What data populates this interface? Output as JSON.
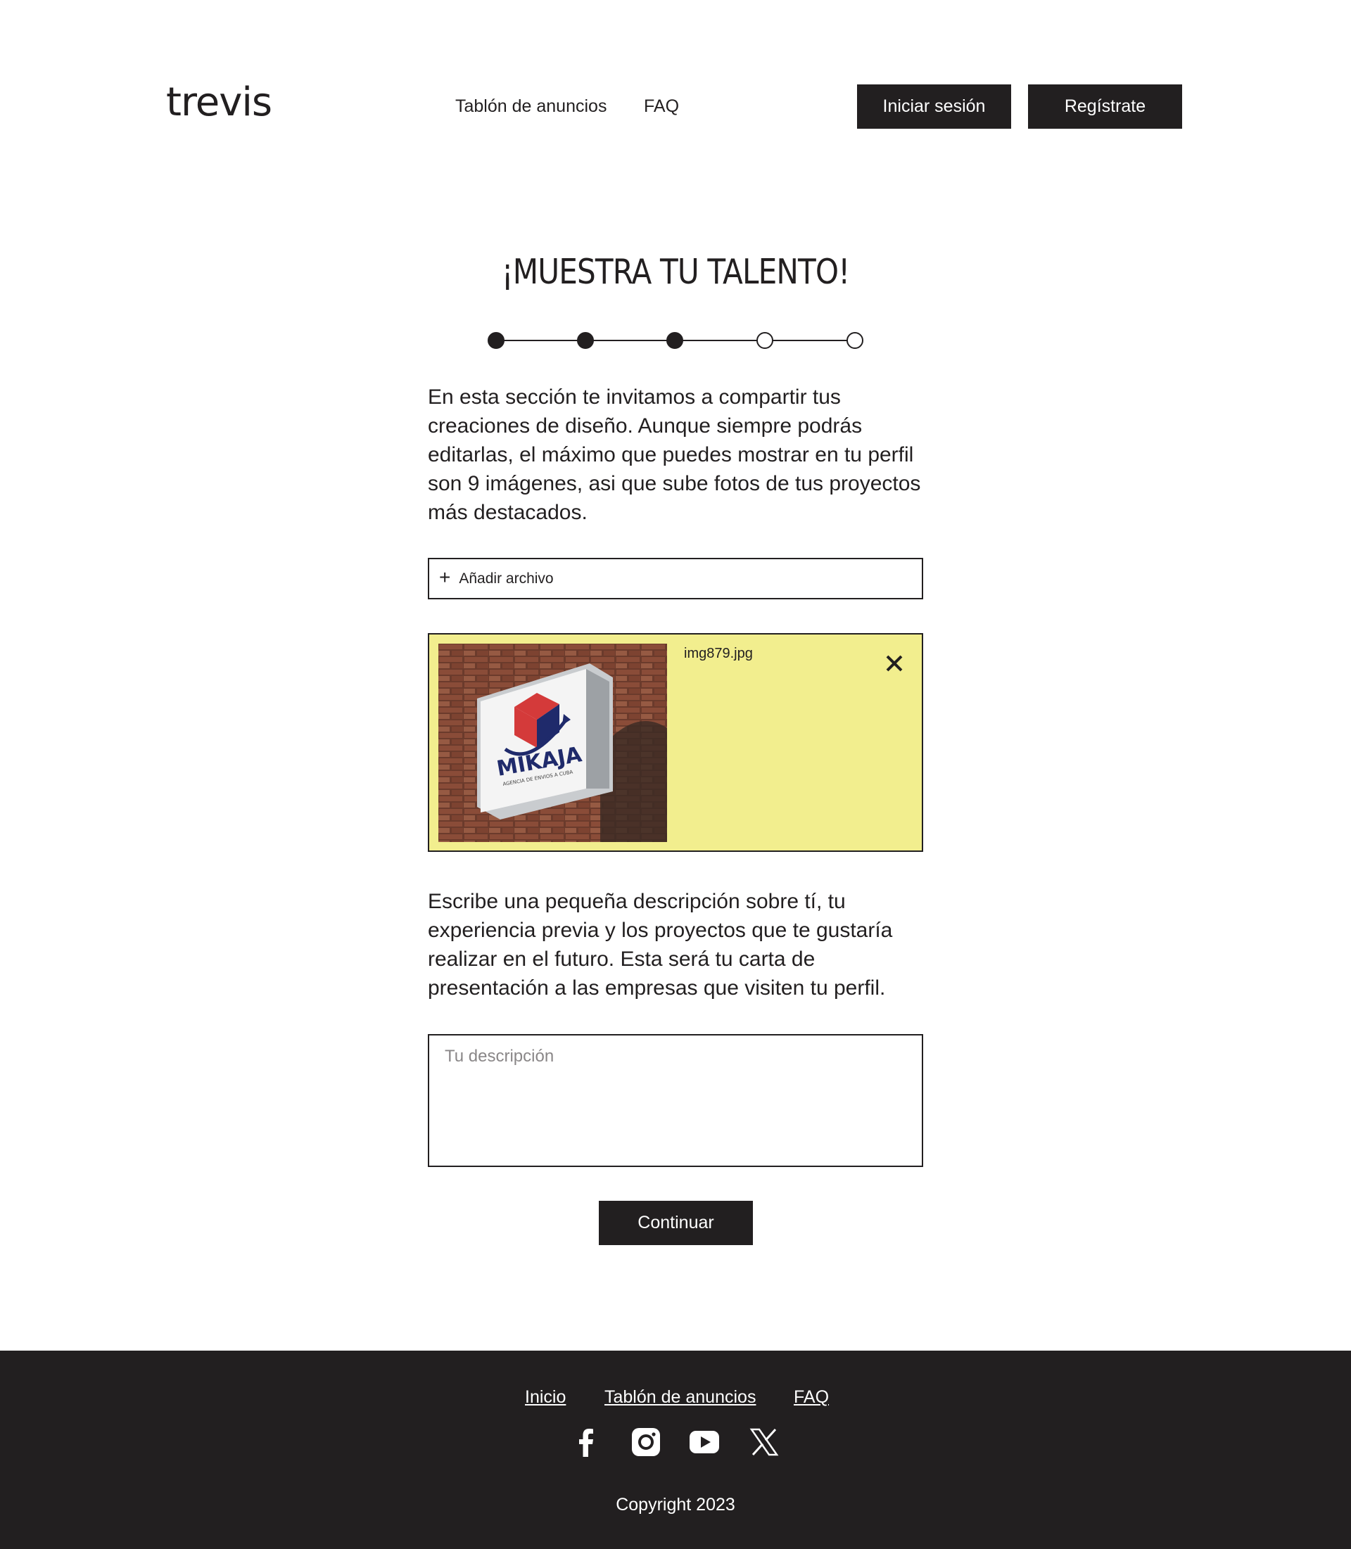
{
  "header": {
    "logo": "trevis",
    "nav": {
      "anuncios": "Tablón de anuncios",
      "faq": "FAQ"
    },
    "login_label": "Iniciar sesión",
    "register_label": "Regístrate"
  },
  "main": {
    "title": "¡MUESTRA TU TALENTO!",
    "stepper": {
      "total_steps": 5,
      "completed_steps": 3
    },
    "intro_text": "En esta sección te invitamos a compartir tus creaciones de diseño. Aunque siempre podrás editarlas, el máximo que puedes mostrar en tu perfil son 9 imágenes, asi que sube fotos de tus proyectos más destacados.",
    "add_file": {
      "icon": "plus-icon",
      "label": "Añadir archivo"
    },
    "uploaded_file": {
      "name": "img879.jpg",
      "thumbnail_text": "MIKAJA",
      "thumbnail_subtext": "AGENCIA DE ENVIOS A CUBA",
      "remove_icon": "close-icon"
    },
    "description_prompt": "Escribe una pequeña descripción sobre tí, tu experiencia previa y los proyectos que te gustaría realizar en el futuro. Esta será tu carta de presentación a las empresas que visiten tu perfil.",
    "description_placeholder": "Tu descripción",
    "continue_label": "Continuar"
  },
  "footer": {
    "links": {
      "inicio": "Inicio",
      "anuncios": "Tablón de anuncios",
      "faq": "FAQ"
    },
    "social_icons": [
      "facebook-icon",
      "instagram-icon",
      "youtube-icon",
      "x-icon"
    ],
    "copyright": "Copyright 2023"
  },
  "colors": {
    "dark": "#221f20",
    "card_yellow": "#f2ee8e",
    "white": "#ffffff"
  }
}
